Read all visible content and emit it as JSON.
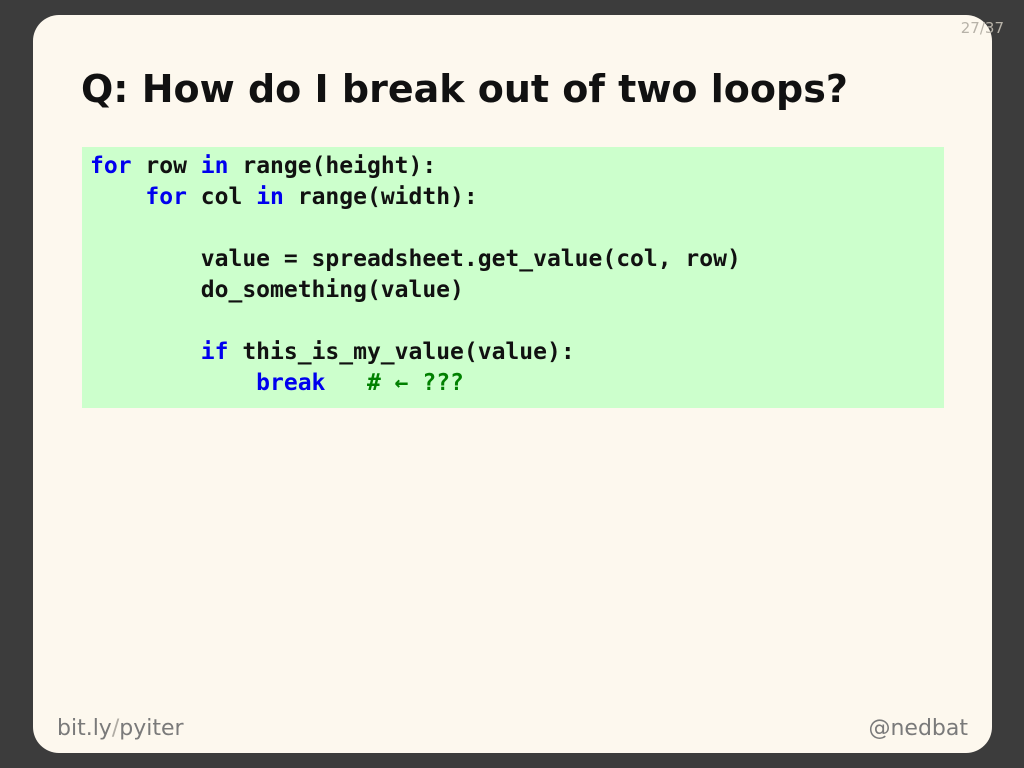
{
  "slide": {
    "counter": "27/37",
    "title": "Q: How do I break out of two loops?"
  },
  "code": {
    "lines": [
      [
        {
          "t": "for",
          "k": "kw"
        },
        {
          "t": " row ",
          "k": ""
        },
        {
          "t": "in",
          "k": "kw"
        },
        {
          "t": " range(height):",
          "k": ""
        }
      ],
      [
        {
          "t": "    ",
          "k": ""
        },
        {
          "t": "for",
          "k": "kw"
        },
        {
          "t": " col ",
          "k": ""
        },
        {
          "t": "in",
          "k": "kw"
        },
        {
          "t": " range(width):",
          "k": ""
        }
      ],
      [
        {
          "t": "",
          "k": ""
        }
      ],
      [
        {
          "t": "        value = spreadsheet.get_value(col, row)",
          "k": ""
        }
      ],
      [
        {
          "t": "        do_something(value)",
          "k": ""
        }
      ],
      [
        {
          "t": "",
          "k": ""
        }
      ],
      [
        {
          "t": "        ",
          "k": ""
        },
        {
          "t": "if",
          "k": "kw"
        },
        {
          "t": " this_is_my_value(value):",
          "k": ""
        }
      ],
      [
        {
          "t": "            ",
          "k": ""
        },
        {
          "t": "break",
          "k": "kw"
        },
        {
          "t": "   ",
          "k": ""
        },
        {
          "t": "# ← ???",
          "k": "cm"
        }
      ]
    ]
  },
  "footer": {
    "left_part1": "bit.ly",
    "left_sep": "/",
    "left_part2": "pyiter",
    "right": "@nedbat"
  },
  "colors": {
    "keyword": "#0000ee",
    "comment": "#008000",
    "code_background": "#ccffcc",
    "slide_background": "#fdf8ee"
  }
}
